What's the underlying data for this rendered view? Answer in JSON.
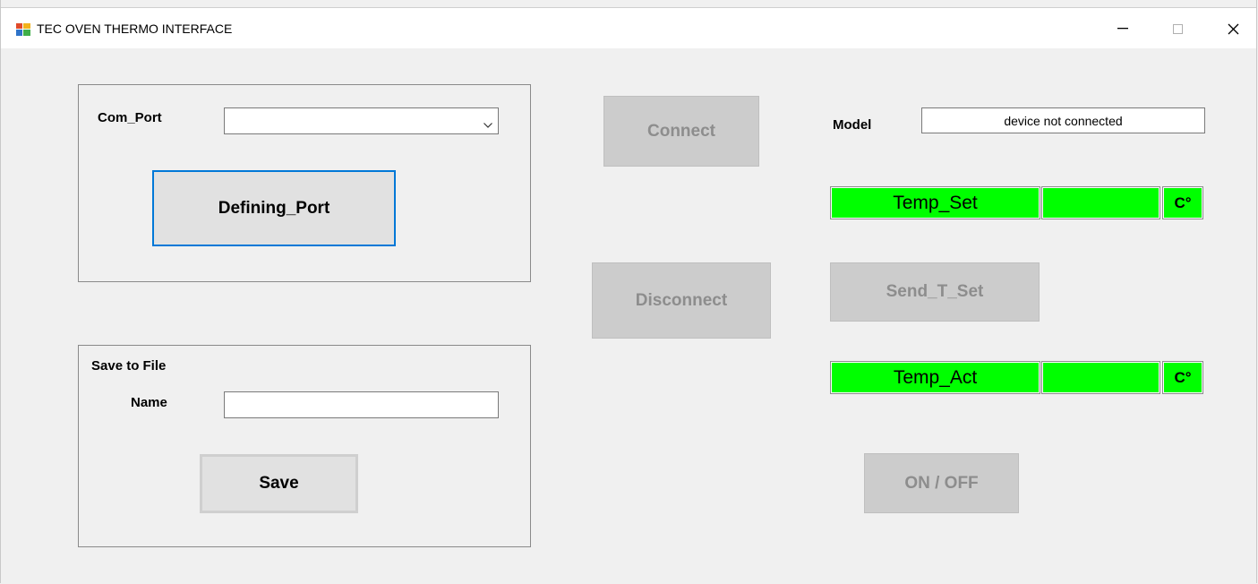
{
  "window": {
    "title": "TEC OVEN THERMO INTERFACE",
    "controls": {
      "minimize": "minimize",
      "maximize": "maximize",
      "close": "close"
    }
  },
  "port_group": {
    "com_port_label": "Com_Port",
    "com_port_value": "",
    "define_button": "Defining_Port"
  },
  "save_group": {
    "title": "Save to File",
    "name_label": "Name",
    "name_value": "",
    "save_button": "Save"
  },
  "connection": {
    "connect_button": "Connect",
    "disconnect_button": "Disconnect"
  },
  "device": {
    "model_label": "Model",
    "model_value": "device not connected"
  },
  "temperature": {
    "set_label": "Temp_Set",
    "set_value": "",
    "set_unit": "C°",
    "send_button": "Send_T_Set",
    "act_label": "Temp_Act",
    "act_value": "",
    "act_unit": "C°",
    "onoff_button": "ON / OFF"
  },
  "colors": {
    "indicator_green": "#00ff00",
    "focus_blue": "#0078d7",
    "disabled_gray": "#cccccc"
  },
  "icons": [
    "app-icon",
    "minimize-icon",
    "maximize-icon",
    "close-icon",
    "chevron-down-icon"
  ]
}
